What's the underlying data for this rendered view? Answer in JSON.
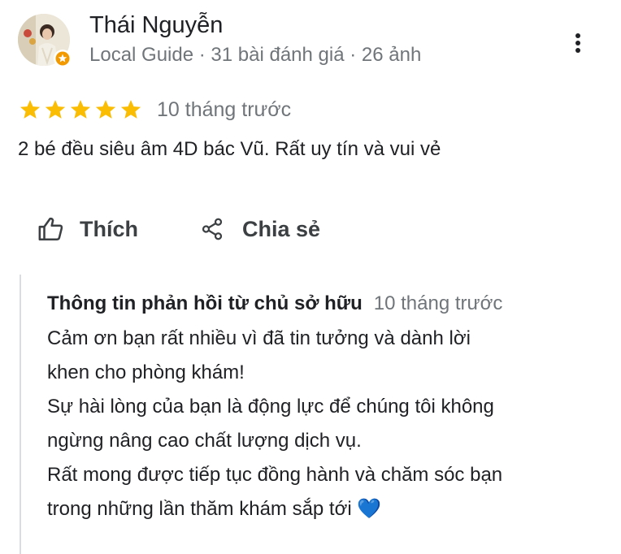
{
  "review": {
    "author": {
      "name": "Thái Nguyễn",
      "meta": "Local Guide · 31 bài đánh giá · 26 ảnh",
      "avatar_icon": "user-avatar-photo",
      "badge_icon": "local-guide-star-icon"
    },
    "more_icon": "more-vert-icon",
    "rating": 5,
    "rating_max": 5,
    "star_color": "#fbbc04",
    "time": "10 tháng trước",
    "text": "2 bé đều siêu âm 4D bác Vũ. Rất uy tín và vui vẻ",
    "actions": {
      "like_label": "Thích",
      "like_icon": "thumb-up-icon",
      "share_label": "Chia sẻ",
      "share_icon": "share-icon"
    }
  },
  "owner_reply": {
    "title": "Thông tin phản hồi từ chủ sở hữu",
    "time": "10 tháng trước",
    "lines": [
      "Cảm ơn bạn rất nhiều vì đã tin tưởng và dành lời",
      "khen cho phòng khám!",
      "Sự hài lòng của bạn là động lực để chúng tôi không",
      "ngừng nâng cao chất lượng dịch vụ.",
      "Rất mong được tiếp tục đồng hành và chăm sóc bạn",
      "trong những lần thăm khám sắp tới 💙"
    ]
  },
  "colors": {
    "text_primary": "#202124",
    "text_secondary": "#70757a",
    "divider": "#dadce0",
    "heart": "#3b7be0"
  }
}
